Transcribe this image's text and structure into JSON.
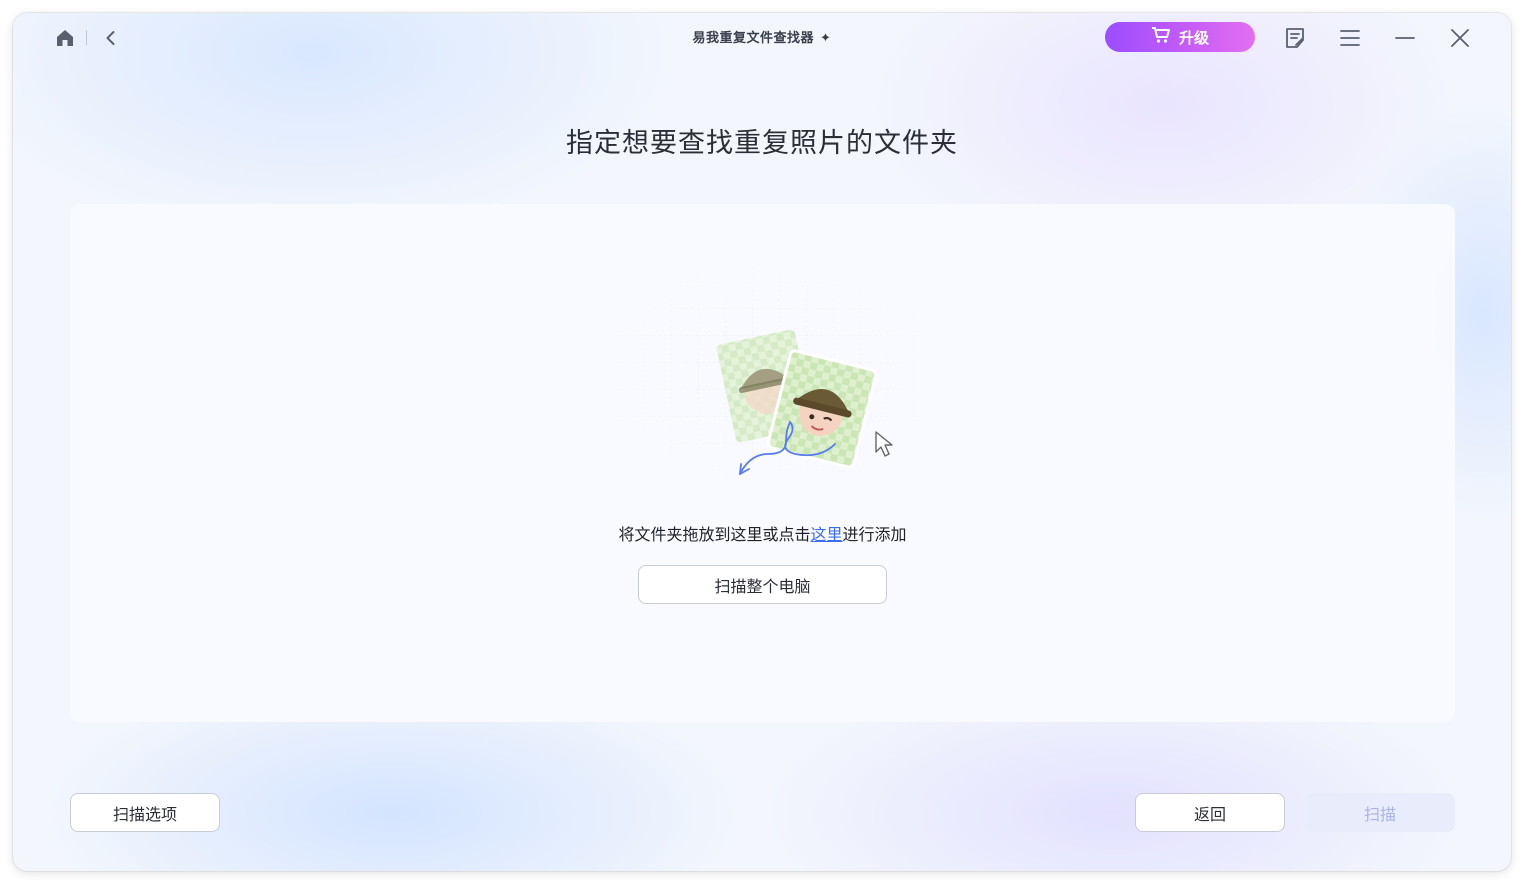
{
  "app": {
    "title": "易我重复文件查找器",
    "upgrade_label": "升级"
  },
  "icons": {
    "home": "home-icon",
    "back": "chevron-left-icon",
    "sparkle": "sparkle-icon",
    "cart": "cart-icon",
    "feedback": "feedback-icon",
    "menu": "menu-icon",
    "minimize": "minimize-icon",
    "close": "close-icon"
  },
  "main": {
    "title": "指定想要查找重复照片的文件夹",
    "drop_text_before": "将文件夹拖放到这里或点击",
    "drop_link": "这里",
    "drop_text_after": "进行添加",
    "scan_pc_label": "扫描整个电脑"
  },
  "footer": {
    "scan_options_label": "扫描选项",
    "back_label": "返回",
    "scan_label": "扫描"
  },
  "colors": {
    "accent": "#3a6df0",
    "upgrade_gradient_start": "#9b4dff",
    "upgrade_gradient_end": "#e36ff0",
    "disabled_text": "#a9b4e8"
  }
}
